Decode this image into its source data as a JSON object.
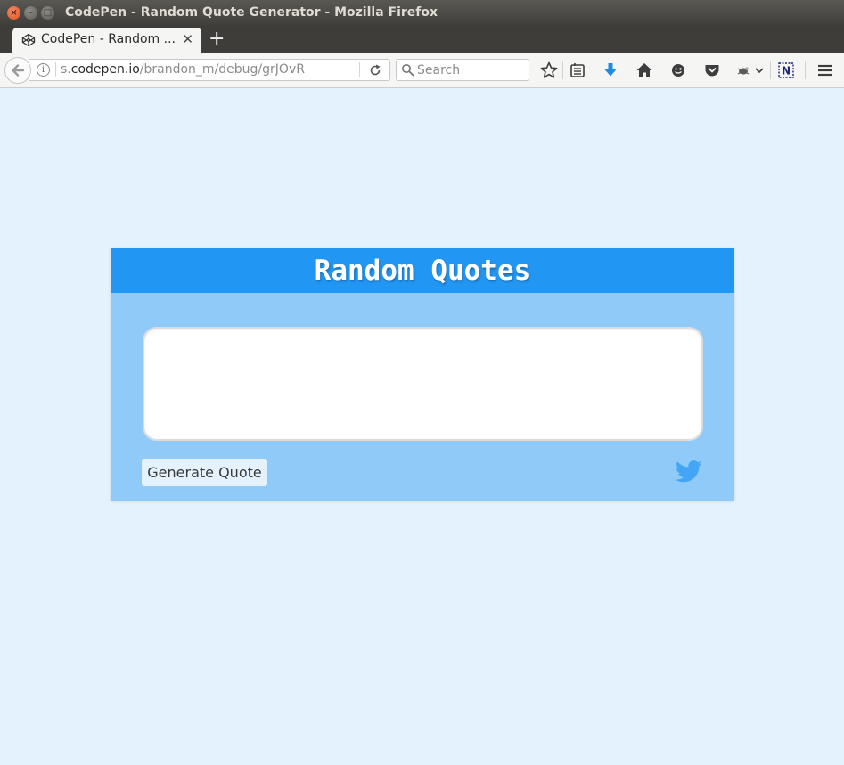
{
  "window": {
    "title": "CodePen - Random Quote Generator - Mozilla Firefox"
  },
  "tabs": [
    {
      "label": "CodePen - Random ...",
      "favicon": "codepen-icon",
      "active": true
    }
  ],
  "navbar": {
    "url_prefix": "s.",
    "url_domain": "codepen.io",
    "url_path": "/brandon_m/debug/grJOvR",
    "search_placeholder": "Search"
  },
  "page": {
    "title": "Random Quotes",
    "quote_text": "",
    "generate_label": "Generate Quote",
    "share_icon": "twitter-icon"
  },
  "colors": {
    "page_bg": "#e3f2fd",
    "card_bg": "#90caf9",
    "header_bg": "#2196f3",
    "twitter": "#42a5f5"
  }
}
